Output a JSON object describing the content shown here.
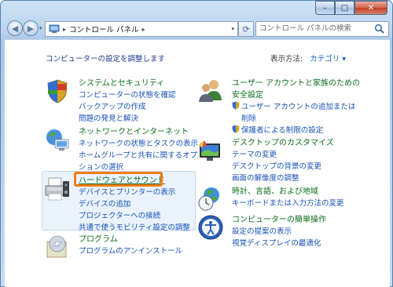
{
  "address": {
    "crumbs": [
      "コントロール パネル"
    ],
    "search_placeholder": "コントロール パネルの検索"
  },
  "header": {
    "heading": "コンピューターの設定を調整します",
    "viewby_label": "表示方法:",
    "viewby_value": "カテゴリ ▾"
  },
  "left": [
    {
      "title": "システムとセキュリティ",
      "links": [
        "コンピューターの状態を確認",
        "バックアップの作成",
        "問題の発見と解決"
      ]
    },
    {
      "title": "ネットワークとインターネット",
      "links": [
        "ネットワークの状態とタスクの表示",
        "ホームグループと共有に関するオプ",
        "ションの選択"
      ]
    },
    {
      "title": "ハードウェアとサウンド",
      "links": [
        "デバイスとプリンターの表示",
        "デバイスの追加",
        "プロジェクターへの接続",
        "共通で使うモビリティ設定の調整"
      ]
    },
    {
      "title": "プログラム",
      "links": [
        "プログラムのアンインストール"
      ]
    }
  ],
  "right": [
    {
      "title_lines": [
        "ユーザー アカウントと家族のための",
        "安全設定"
      ],
      "shield_links": [
        "ユーザー アカウントの追加または",
        "削除",
        "保護者による制限の設定"
      ]
    },
    {
      "title": "デスクトップのカスタマイズ",
      "links": [
        "テーマの変更",
        "デスクトップの背景の変更",
        "画面の解像度の調整"
      ]
    },
    {
      "title": "時計、言語、および地域",
      "links": [
        "キーボードまたは入力方法の変更"
      ]
    },
    {
      "title": "コンピューターの簡単操作",
      "links": [
        "設定の提案の表示",
        "視覚ディスプレイの最適化"
      ]
    }
  ],
  "colors": {
    "category_title": "#0a6e1a",
    "link": "#1751b9",
    "highlight": "#f47c14"
  }
}
